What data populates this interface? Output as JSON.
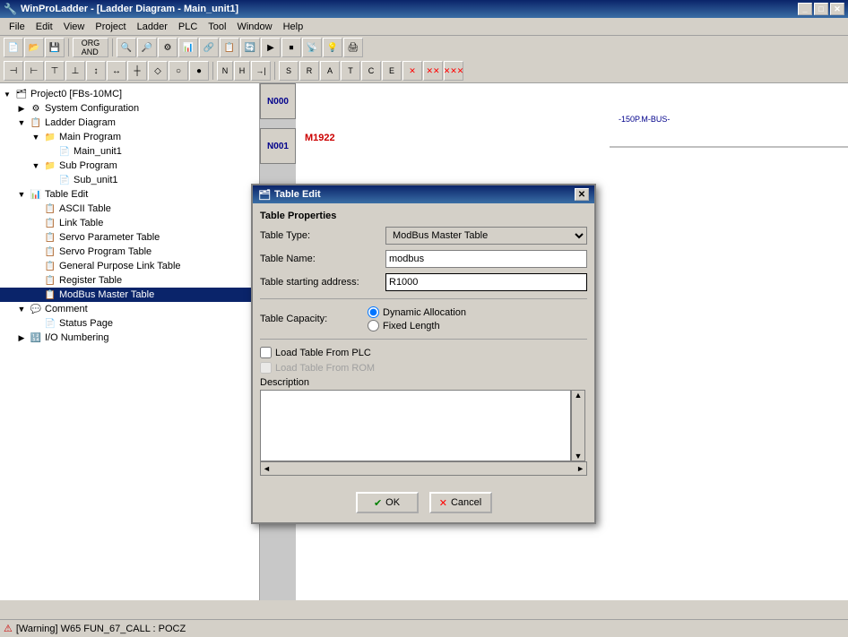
{
  "app": {
    "title": "WinProLadder - [Ladder Diagram - Main_unit1]",
    "icon": "🔧"
  },
  "menu": {
    "items": [
      "File",
      "Edit",
      "View",
      "Project",
      "Ladder",
      "PLC",
      "Tool",
      "Window",
      "Help"
    ]
  },
  "tree": {
    "root_label": "Project0 [FBs-10MC]",
    "items": [
      {
        "id": "system-config",
        "label": "System Configuration",
        "level": 1,
        "icon": "⚙",
        "expanded": false
      },
      {
        "id": "ladder-diagram",
        "label": "Ladder Diagram",
        "level": 1,
        "icon": "📋",
        "expanded": true
      },
      {
        "id": "main-program",
        "label": "Main Program",
        "level": 2,
        "icon": "📁",
        "expanded": true
      },
      {
        "id": "main-unit1",
        "label": "Main_unit1",
        "level": 3,
        "icon": "📄",
        "expanded": false
      },
      {
        "id": "sub-program",
        "label": "Sub Program",
        "level": 2,
        "icon": "📁",
        "expanded": true
      },
      {
        "id": "sub-unit1",
        "label": "Sub_unit1",
        "level": 3,
        "icon": "📄",
        "expanded": false
      },
      {
        "id": "table-edit",
        "label": "Table Edit",
        "level": 1,
        "icon": "📊",
        "expanded": true
      },
      {
        "id": "ascii-table",
        "label": "ASCII Table",
        "level": 2,
        "icon": "📋",
        "expanded": false
      },
      {
        "id": "link-table",
        "label": "Link Table",
        "level": 2,
        "icon": "📋",
        "expanded": false
      },
      {
        "id": "servo-param-table",
        "label": "Servo Parameter Table",
        "level": 2,
        "icon": "📋",
        "expanded": false
      },
      {
        "id": "servo-prog-table",
        "label": "Servo Program Table",
        "level": 2,
        "icon": "📋",
        "expanded": false
      },
      {
        "id": "general-link-table",
        "label": "General Purpose Link Table",
        "level": 2,
        "icon": "📋",
        "expanded": false
      },
      {
        "id": "register-table",
        "label": "Register Table",
        "level": 2,
        "icon": "📋",
        "expanded": false
      },
      {
        "id": "modbus-master-table",
        "label": "ModBus Master Table",
        "level": 2,
        "icon": "📋",
        "selected": true
      },
      {
        "id": "comment",
        "label": "Comment",
        "level": 1,
        "icon": "💬",
        "expanded": false
      },
      {
        "id": "status-page",
        "label": "Status Page",
        "level": 2,
        "icon": "📄",
        "expanded": false
      },
      {
        "id": "io-numbering",
        "label": "I/O Numbering",
        "level": 1,
        "icon": "🔢",
        "expanded": false
      }
    ]
  },
  "dialog": {
    "title": "Table Edit",
    "sections": {
      "properties": "Table Properties",
      "capacity": "Table Capacity:",
      "description": "Description"
    },
    "fields": {
      "table_type_label": "Table Type:",
      "table_type_value": "ModBus Master Table",
      "table_name_label": "Table Name:",
      "table_name_value": "modbus",
      "table_address_label": "Table starting address:",
      "table_address_value": "R1000"
    },
    "radio_options": [
      {
        "id": "dynamic",
        "label": "Dynamic Allocation",
        "checked": true
      },
      {
        "id": "fixed",
        "label": "Fixed Length",
        "checked": false
      }
    ],
    "checkboxes": [
      {
        "id": "load-from-plc",
        "label": "Load Table From PLC",
        "checked": false,
        "disabled": false
      },
      {
        "id": "load-from-rom",
        "label": "Load Table From ROM",
        "checked": false,
        "disabled": true
      }
    ],
    "buttons": {
      "ok": "OK",
      "cancel": "Cancel"
    }
  },
  "status": {
    "warning": "[Warning] W65 FUN_67_CALL  : POCZ"
  },
  "ladder": {
    "rungs": [
      {
        "id": "N000",
        "label": "N000"
      },
      {
        "id": "N001",
        "label": "N001"
      }
    ],
    "element": {
      "coil_label": "M1922",
      "annotation": "-150P.M-BUS-"
    }
  }
}
